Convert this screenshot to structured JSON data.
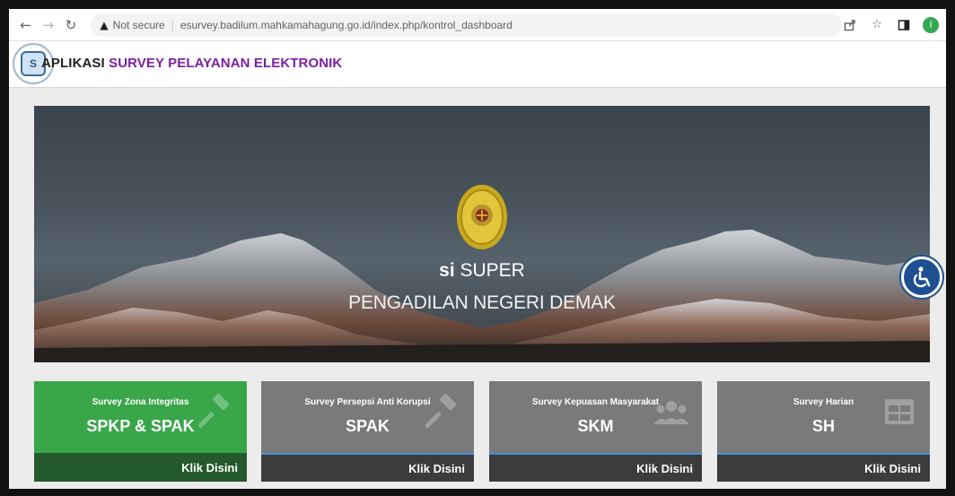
{
  "browser": {
    "security_label": "Not secure",
    "url": "esurvey.badilum.mahkamahagung.go.id/index.php/kontrol_dashboard",
    "profile_initial": "I"
  },
  "header": {
    "title_prefix": "APLIKASI",
    "title_accent": "SURVEY PELAYANAN ELEKTRONIK",
    "accent_color": "#7b1fa2"
  },
  "hero": {
    "brand_bold": "si",
    "brand_rest": "SUPER",
    "court_name": "PENGADILAN NEGERI DEMAK"
  },
  "cards": [
    {
      "subtitle": "Survey Zona Integritas",
      "title": "SPKP & SPAK",
      "link": "Klik Disini",
      "color": "#3aa64a",
      "icon": "gavel-icon"
    },
    {
      "subtitle": "Survey Persepsi Anti Korupsi",
      "title": "SPAK",
      "link": "Klik Disini",
      "color": "#7a7a7a",
      "icon": "gavel-icon"
    },
    {
      "subtitle": "Survey Kepuasan Masyarakat",
      "title": "SKM",
      "link": "Klik Disini",
      "color": "#7a7a7a",
      "icon": "users-icon"
    },
    {
      "subtitle": "Survey Harian",
      "title": "SH",
      "link": "Klik Disini",
      "color": "#7a7a7a",
      "icon": "grid-icon"
    }
  ]
}
